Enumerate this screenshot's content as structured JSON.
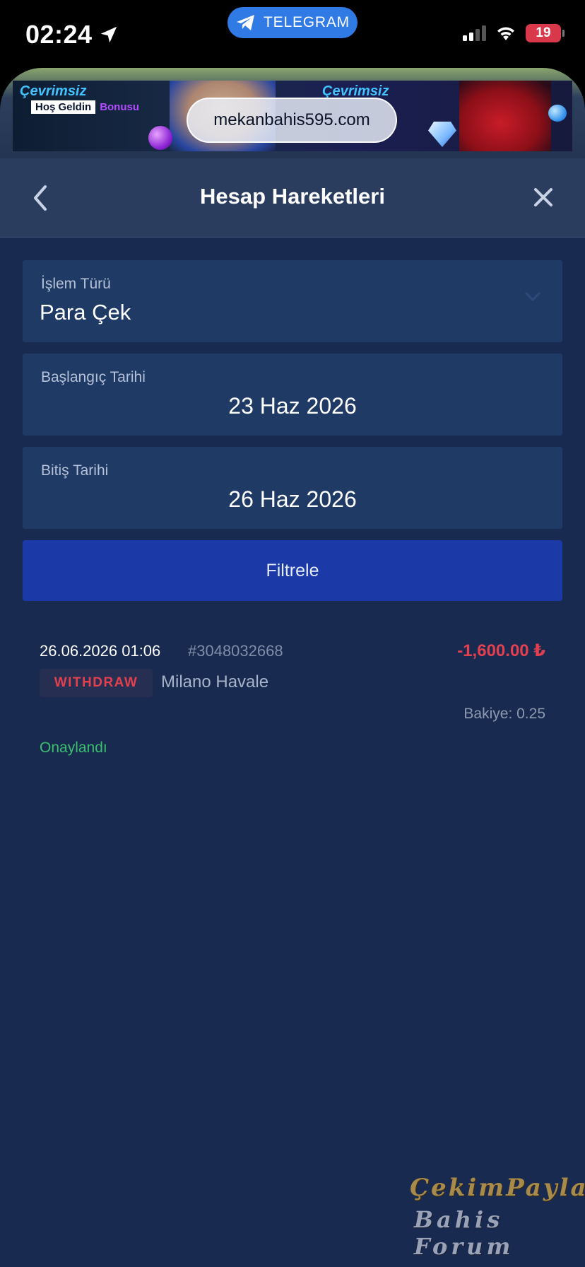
{
  "status_bar": {
    "time": "02:24",
    "pill_label": "TELEGRAM",
    "battery": "19"
  },
  "banner": {
    "url": "mekanbahis595.com",
    "promo_left_title": "Çevrimsiz",
    "promo_left_badge": "Hoş Geldin",
    "promo_left_bonus": "Bonusu",
    "promo_right_title": "Çevrimsiz"
  },
  "header": {
    "title": "Hesap Hareketleri"
  },
  "filters": {
    "type_label": "İşlem Türü",
    "type_value": "Para Çek",
    "start_label": "Başlangıç Tarihi",
    "start_value": "23 Haz 2026",
    "end_label": "Bitiş Tarihi",
    "end_value": "26 Haz 2026",
    "button_label": "Filtrele"
  },
  "transactions": [
    {
      "datetime": "26.06.2026 01:06",
      "id": "#3048032668",
      "amount": "-1,600.00 ₺",
      "type": "WITHDRAW",
      "method": "Milano Havale",
      "balance": "Bakiye: 0.25",
      "status": "Onaylandı"
    }
  ],
  "watermark": {
    "line1": "ÇekimPaylaş",
    "line2": "Bahis Forum"
  },
  "colors": {
    "background": "#192a50",
    "field_bg": "#203a66",
    "button_bg": "#1b3aa8",
    "negative": "#e2404f",
    "approved": "#3bbf6d"
  }
}
